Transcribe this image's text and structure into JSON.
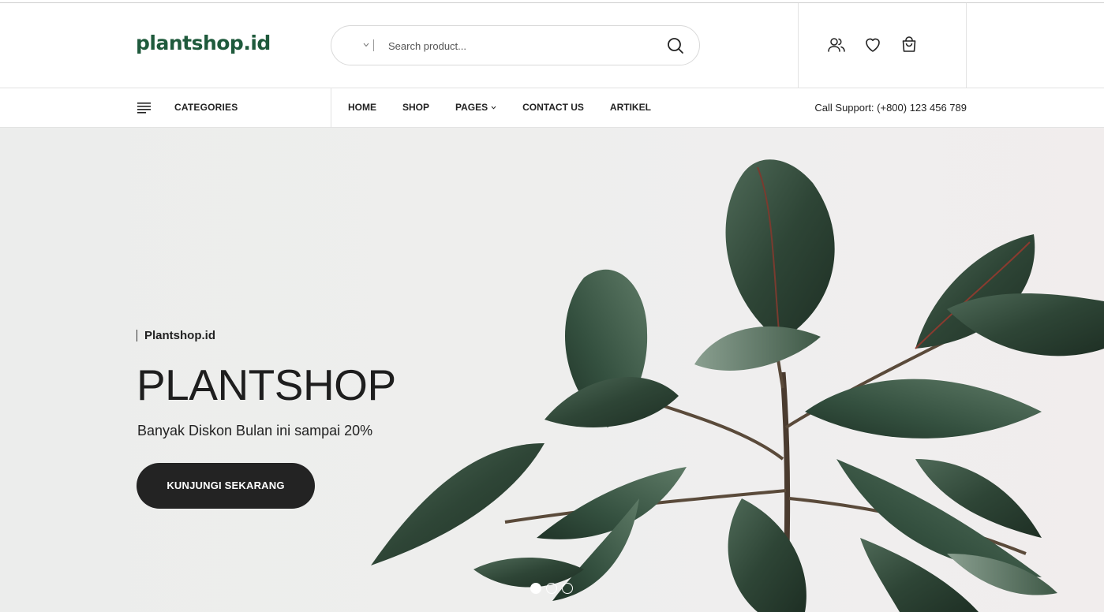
{
  "brand": {
    "logo_text": "plantshop.id"
  },
  "search": {
    "placeholder": "Search product...",
    "category_chevron": "chevron-down-icon"
  },
  "header_actions": [
    {
      "name": "account-icon"
    },
    {
      "name": "wishlist-heart-icon"
    },
    {
      "name": "cart-bag-icon"
    }
  ],
  "nav": {
    "categories_label": "CATEGORIES",
    "links": [
      {
        "label": "HOME"
      },
      {
        "label": "SHOP"
      },
      {
        "label": "PAGES",
        "has_dropdown": true
      },
      {
        "label": "CONTACT US"
      },
      {
        "label": "ARTIKEL"
      }
    ],
    "support_text": "Call Support: (+800) 123 456 789"
  },
  "hero": {
    "tagline": "Plantshop.id",
    "title": "PLANTSHOP",
    "subtitle": "Banyak Diskon Bulan ini sampai 20%",
    "cta_label": "KUNJUNGI SEKARANG",
    "slide_count": 3,
    "active_slide": 1
  },
  "colors": {
    "logo": "#1f5a3c",
    "button": "#232323",
    "hero_bg": "#eeeeed",
    "leaf": "#2f4a3a"
  }
}
